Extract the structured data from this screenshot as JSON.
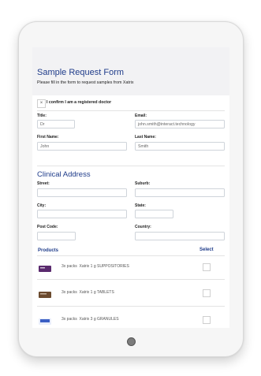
{
  "form": {
    "title": "Sample Request Form",
    "subtitle": "Please fill in the form to request samples from  Xatrix",
    "confirm_icon": "×",
    "confirm_label": "I confirm I am a registered doctor",
    "title_label": "Title:",
    "title_value": "Dr",
    "email_label": "Email:",
    "email_value": "john.smith@interact.technology",
    "first_name_label": "First Name:",
    "first_name_value": "John",
    "last_name_label": "Last Name:",
    "last_name_value": "Smith"
  },
  "address": {
    "section_title": "Clinical Address",
    "street_label": "Street:",
    "street_value": "",
    "suburb_label": "Suburb:",
    "suburb_value": "",
    "city_label": "City:",
    "city_value": "",
    "state_label": "State:",
    "state_value": "",
    "postcode_label": "Post Code:",
    "postcode_value": "",
    "country_label": "Country:",
    "country_value": ""
  },
  "products": {
    "header": "Products",
    "select_header": "Select",
    "items": [
      {
        "quantity": "3x packs",
        "name": "Xatrix  1 g SUPPOSITORIES",
        "image_color": "#5a2a6e"
      },
      {
        "quantity": "3x packs",
        "name": "Xatrix  1 g TABLETS",
        "image_color": "#6b4a2e"
      },
      {
        "quantity": "3x packs",
        "name": "Xatrix  3 g GRANULES",
        "image_color": "#3b5fc4"
      }
    ]
  },
  "colors": {
    "accent": "#1f3c8a",
    "header_bg": "#f2f2f4"
  }
}
